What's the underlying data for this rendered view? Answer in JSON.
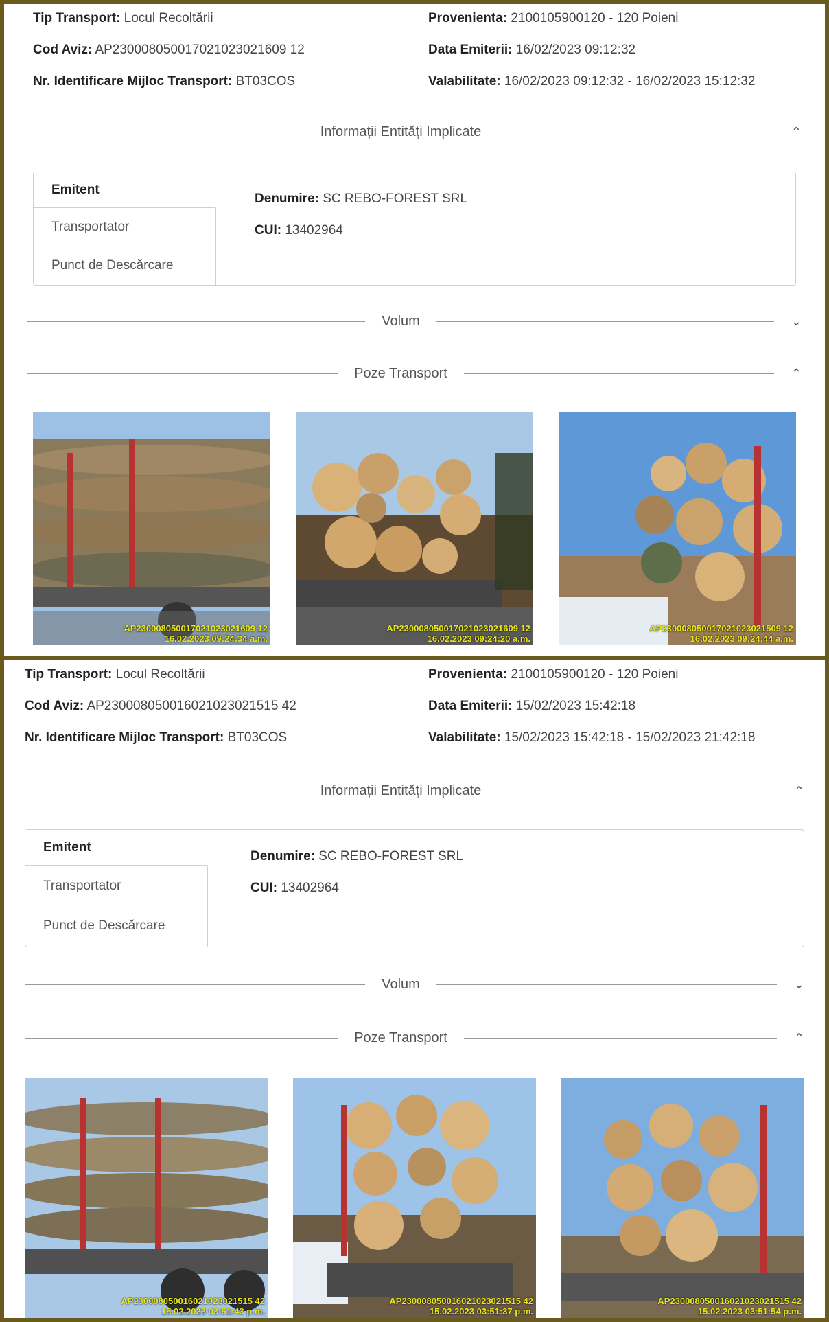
{
  "records": [
    {
      "tip_transport_label": "Tip Transport:",
      "tip_transport": "Locul Recoltării",
      "cod_aviz_label": "Cod Aviz:",
      "cod_aviz": "AP230008050017021023021609 12",
      "nr_label": "Nr. Identificare Mijloc Transport:",
      "nr": "BT03COS",
      "provenienta_label": "Provenienta:",
      "provenienta": "2100105900120 - 120 Poieni",
      "data_emiterii_label": "Data Emiterii:",
      "data_emiterii": "16/02/2023 09:12:32",
      "valabilitate_label": "Valabilitate:",
      "valabilitate": "16/02/2023 09:12:32 - 16/02/2023 15:12:32",
      "section_info": "Informații Entități Implicate",
      "tabs": [
        "Emitent",
        "Transportator",
        "Punct de Descărcare"
      ],
      "denumire_label": "Denumire:",
      "denumire": "SC REBO-FOREST SRL",
      "cui_label": "CUI:",
      "cui": "13402964",
      "section_volum": "Volum",
      "section_poze": "Poze Transport",
      "photos": [
        {
          "code": "AP230008050017021023021609 12",
          "time": "16.02.2023 09:24:34 a.m."
        },
        {
          "code": "AP230008050017021023021609 12",
          "time": "16.02.2023 09:24:20 a.m."
        },
        {
          "code": "AP230008050017021023021509 12",
          "time": "16.02.2023 09:24:44 a.m."
        }
      ]
    },
    {
      "tip_transport_label": "Tip Transport:",
      "tip_transport": "Locul Recoltării",
      "cod_aviz_label": "Cod Aviz:",
      "cod_aviz": "AP230008050016021023021515 42",
      "nr_label": "Nr. Identificare Mijloc Transport:",
      "nr": "BT03COS",
      "provenienta_label": "Provenienta:",
      "provenienta": "2100105900120 - 120 Poieni",
      "data_emiterii_label": "Data Emiterii:",
      "data_emiterii": "15/02/2023 15:42:18",
      "valabilitate_label": "Valabilitate:",
      "valabilitate": "15/02/2023 15:42:18 - 15/02/2023 21:42:18",
      "section_info": "Informații Entități Implicate",
      "tabs": [
        "Emitent",
        "Transportator",
        "Punct de Descărcare"
      ],
      "denumire_label": "Denumire:",
      "denumire": "SC REBO-FOREST SRL",
      "cui_label": "CUI:",
      "cui": "13402964",
      "section_volum": "Volum",
      "section_poze": "Poze Transport",
      "photos": [
        {
          "code": "AP230008050016021023021515 42",
          "time": "15.02.2023 03:51:43 p.m."
        },
        {
          "code": "AP230008050016021023021515 42",
          "time": "15.02.2023 03:51:37 p.m."
        },
        {
          "code": "AP230008050016021023021515 42",
          "time": "15.02.2023 03:51:54 p.m."
        }
      ]
    }
  ],
  "icons": {
    "expanded": "chevron-up-icon",
    "collapsed": "chevron-down-icon"
  },
  "colors": {
    "stamp": "#e6e61a",
    "divider": "#9a9a9a",
    "border": "#cfcfcf"
  }
}
